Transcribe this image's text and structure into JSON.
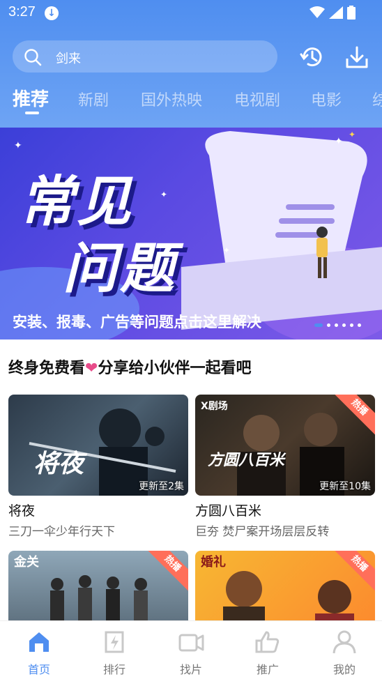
{
  "status": {
    "time": "3:27"
  },
  "search": {
    "text": "剑来"
  },
  "tabs": [
    {
      "label": "推荐",
      "active": true
    },
    {
      "label": "新剧"
    },
    {
      "label": "国外热映"
    },
    {
      "label": "电视剧"
    },
    {
      "label": "电影"
    },
    {
      "label": "综"
    }
  ],
  "banner": {
    "title_line1": "常见",
    "title_line2": "问题",
    "caption": "安装、报毒、广告等问题点击这里解决"
  },
  "section": {
    "title_part1": "终身免费看",
    "title_part2": "分享给小伙伴一起看吧"
  },
  "cards": [
    {
      "title": "将夜",
      "subtitle": "三刀一伞少年行天下",
      "update": "更新至2集",
      "thumb_text": "将夜"
    },
    {
      "title": "方圆八百米",
      "subtitle": "巨夯 焚尸案开场层层反转",
      "update": "更新至10集",
      "badge": "热播",
      "logo": "X剧场",
      "thumb_text": "方圆八百米"
    },
    {
      "badge": "热播",
      "logo": "金关"
    },
    {
      "badge": "热播",
      "logo": "婚礼"
    }
  ],
  "nav": [
    {
      "label": "首页",
      "icon": "home-icon",
      "active": true
    },
    {
      "label": "排行",
      "icon": "rank-icon"
    },
    {
      "label": "找片",
      "icon": "video-icon"
    },
    {
      "label": "推广",
      "icon": "thumb-up-icon"
    },
    {
      "label": "我的",
      "icon": "user-icon"
    }
  ],
  "colors": {
    "accent": "#4f8ef0",
    "hot": "#ff6f5a",
    "banner": "#5a4ae2"
  }
}
